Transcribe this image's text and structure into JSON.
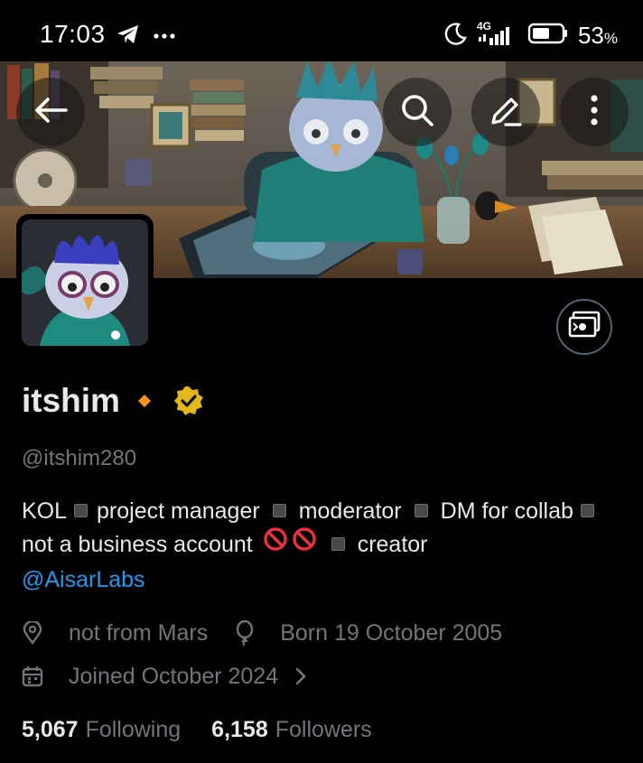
{
  "status_bar": {
    "time": "17:03",
    "network": "4G",
    "battery_percent": "53",
    "battery_unit": "%",
    "icons": [
      "telegram-icon",
      "more-dots-icon",
      "moon-icon",
      "signal-icon",
      "battery-icon"
    ]
  },
  "header": {
    "back_icon": "arrow-left-icon",
    "search_icon": "search-icon",
    "edit_icon": "pencil-icon",
    "more_icon": "more-vertical-icon"
  },
  "profile": {
    "display_name": "itshim",
    "handle": "@itshim280",
    "bio": {
      "segment_1": "KOL",
      "segment_2": "project manager",
      "segment_3": "moderator",
      "segment_4": "DM for collab",
      "segment_5": "not a business account",
      "segment_6": "creator",
      "mention": "@AisarLabs"
    },
    "location": "not from Mars",
    "birthday": "Born 19 October 2005",
    "joined": "Joined October 2024",
    "following_count": "5,067",
    "following_label": "Following",
    "followers_count": "6,158",
    "followers_label": "Followers"
  },
  "colors": {
    "background": "#000000",
    "text_primary": "#e7e9ea",
    "text_secondary": "#71767b",
    "link": "#1d9bf0",
    "verified_badge": "#e2b719",
    "affiliate_diamond": "#f7931a"
  }
}
